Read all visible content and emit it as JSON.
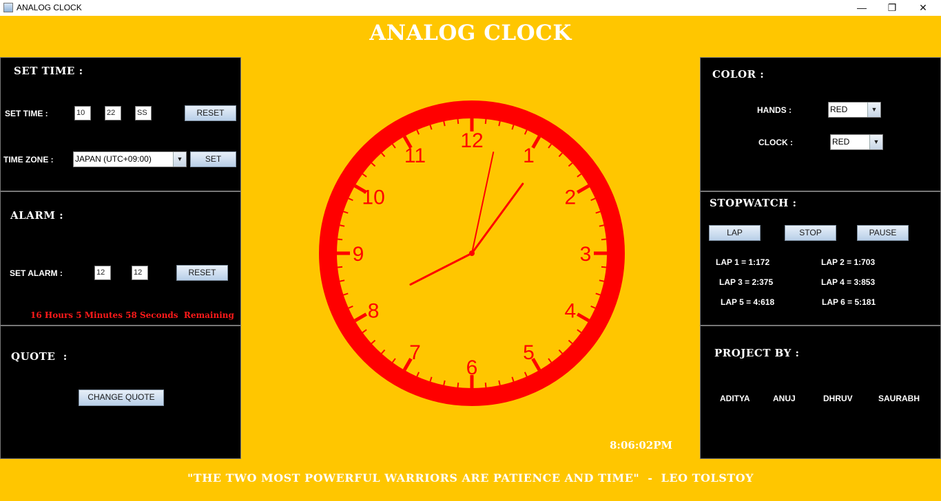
{
  "window": {
    "title": "ANALOG CLOCK",
    "minimize_icon": "minimize-icon",
    "maximize_icon": "restore-icon",
    "close_icon": "close-icon"
  },
  "header": {
    "title": "ANALOG CLOCK"
  },
  "set_time": {
    "title": "SET TIME :",
    "label": "SET TIME :",
    "hour": "10",
    "minute": "22",
    "second": "SS",
    "reset_label": "RESET",
    "timezone_label": "TIME ZONE :",
    "timezone_value": "JAPAN (UTC+09:00)",
    "set_label": "SET"
  },
  "alarm": {
    "title": "ALARM :",
    "label": "SET ALARM :",
    "hour": "12",
    "minute": "12",
    "reset_label": "RESET",
    "remaining": "16 Hours 5 Minutes 58 Seconds  Remaining"
  },
  "quote": {
    "title": "QUOTE  :",
    "change_label": "CHANGE QUOTE"
  },
  "clock": {
    "numerals": [
      "12",
      "1",
      "2",
      "3",
      "4",
      "5",
      "6",
      "7",
      "8",
      "9",
      "10",
      "11"
    ],
    "time": {
      "hour": 8,
      "minute": 6,
      "second": 2
    },
    "color": "#ff0000",
    "digital": "8:06:02PM"
  },
  "color": {
    "title": "COLOR :",
    "hands_label": "HANDS :",
    "hands_value": "RED",
    "clock_label": "CLOCK :",
    "clock_value": "RED"
  },
  "stopwatch": {
    "title": "STOPWATCH :",
    "lap_label": "LAP",
    "stop_label": "STOP",
    "pause_label": "PAUSE",
    "laps": [
      "LAP 1 = 1:172",
      "LAP 2 = 1:703",
      "LAP 3 = 2:375",
      "LAP 4 = 3:853",
      "LAP 5 = 4:618",
      "LAP 6 = 5:181"
    ]
  },
  "project": {
    "title": "PROJECT BY :",
    "members": [
      "ADITYA",
      "ANUJ",
      "DHRUV",
      "SAURABH"
    ]
  },
  "footer": {
    "quote": "\"THE TWO MOST POWERFUL WARRIORS ARE PATIENCE AND TIME\"  -  LEO TOLSTOY"
  },
  "colors": {
    "background": "#ffc600",
    "panel": "#000000",
    "accent": "#ff0000",
    "text": "#ffffff"
  }
}
